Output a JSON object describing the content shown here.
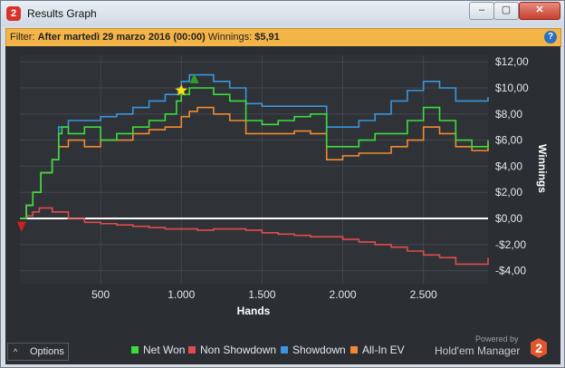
{
  "window": {
    "title": "Results Graph",
    "app_icon": "2",
    "min": "–",
    "max": "▢",
    "close": "✕"
  },
  "filter": {
    "label": "Filter:",
    "value": "After martedì 29 marzo 2016 (00:00)",
    "winnings_label": "Winnings:",
    "winnings_value": "$5,91",
    "help_icon": "?"
  },
  "chart_data": {
    "type": "line",
    "xlabel": "Hands",
    "ylabel": "Winnings",
    "xlim": [
      0,
      2900
    ],
    "ylim": [
      -5,
      12.5
    ],
    "x_ticks": [
      500,
      1000,
      1500,
      2000,
      2500
    ],
    "x_tick_labels": [
      "500",
      "1.000",
      "1.500",
      "2.000",
      "2.500"
    ],
    "y_ticks": [
      12,
      10,
      8,
      6,
      4,
      2,
      0,
      -2,
      -4
    ],
    "y_tick_labels": [
      "$12,00",
      "$10,00",
      "$8,00",
      "$6,00",
      "$4,00",
      "$2,00",
      "$0,00",
      "-$2,00",
      "-$4,00"
    ],
    "grid": true,
    "legend_position": "bottom",
    "series": [
      {
        "name": "Net Won",
        "color": "#3ddc3d",
        "x": [
          0,
          40,
          80,
          130,
          200,
          240,
          260,
          300,
          400,
          500,
          600,
          700,
          800,
          900,
          970,
          1000,
          1050,
          1100,
          1200,
          1300,
          1400,
          1450,
          1500,
          1600,
          1700,
          1800,
          1900,
          1950,
          2000,
          2100,
          2200,
          2300,
          2400,
          2500,
          2600,
          2700,
          2800,
          2900
        ],
        "y": [
          0,
          1,
          2,
          3.5,
          4.5,
          6.5,
          7,
          6.5,
          7,
          6,
          6.5,
          7,
          7.5,
          8,
          9,
          9.5,
          10,
          10,
          9.5,
          9,
          7.5,
          7.5,
          7.2,
          7.5,
          7.8,
          8,
          5.5,
          5.5,
          5.5,
          6,
          6.5,
          6.5,
          7.5,
          8.5,
          7.5,
          6,
          5.5,
          6
        ]
      },
      {
        "name": "Non Showdown",
        "color": "#e04c4c",
        "x": [
          0,
          40,
          80,
          120,
          200,
          300,
          400,
          500,
          600,
          700,
          800,
          900,
          1000,
          1100,
          1200,
          1300,
          1400,
          1500,
          1600,
          1700,
          1800,
          1900,
          2000,
          2100,
          2200,
          2300,
          2400,
          2500,
          2600,
          2700,
          2800,
          2900
        ],
        "y": [
          0,
          0.2,
          0.5,
          0.8,
          0.5,
          0,
          -0.3,
          -0.4,
          -0.5,
          -0.6,
          -0.7,
          -0.8,
          -0.8,
          -0.9,
          -0.8,
          -0.8,
          -0.9,
          -1.1,
          -1.2,
          -1.3,
          -1.4,
          -1.4,
          -1.6,
          -1.8,
          -2,
          -2.2,
          -2.5,
          -2.8,
          -3,
          -3.5,
          -3.5,
          -3
        ]
      },
      {
        "name": "Showdown",
        "color": "#3c96dc",
        "x": [
          0,
          40,
          80,
          130,
          200,
          240,
          300,
          400,
          500,
          600,
          700,
          800,
          900,
          980,
          1000,
          1050,
          1100,
          1200,
          1300,
          1400,
          1450,
          1500,
          1600,
          1700,
          1800,
          1900,
          1950,
          2000,
          2100,
          2200,
          2300,
          2400,
          2500,
          2600,
          2650,
          2700,
          2800,
          2900
        ],
        "y": [
          0,
          1,
          2,
          3.5,
          4.5,
          7,
          7.5,
          7.5,
          7.8,
          8,
          8.5,
          9,
          9.5,
          10,
          10.5,
          11,
          11,
          10.5,
          10,
          8.8,
          8.8,
          8.6,
          8.6,
          8.6,
          8.6,
          7,
          7,
          7,
          7.5,
          8,
          9,
          9.8,
          10.5,
          10,
          10,
          9,
          9,
          9.3
        ]
      },
      {
        "name": "All-In EV",
        "color": "#f08a30",
        "x": [
          0,
          40,
          80,
          130,
          200,
          240,
          300,
          400,
          500,
          600,
          700,
          800,
          900,
          1000,
          1050,
          1100,
          1200,
          1300,
          1400,
          1500,
          1600,
          1700,
          1800,
          1900,
          1950,
          2000,
          2100,
          2200,
          2300,
          2400,
          2500,
          2600,
          2700,
          2800,
          2900
        ],
        "y": [
          0,
          1,
          2,
          3.5,
          4.5,
          5.5,
          6,
          5.5,
          6,
          6,
          6.5,
          6.8,
          7,
          7.8,
          8.2,
          8.5,
          8,
          7.5,
          6.5,
          6.5,
          6.5,
          6.7,
          6.5,
          4.5,
          4.5,
          4.8,
          5,
          5,
          5.5,
          6,
          7,
          6.5,
          5.5,
          5.2,
          5.8
        ]
      }
    ],
    "markers": [
      {
        "kind": "star",
        "x": 1000,
        "y": 9.8,
        "color": "#f7e31a"
      },
      {
        "kind": "triangle-up",
        "x": 1080,
        "y": 10.7,
        "color": "#2f9e2f"
      },
      {
        "kind": "triangle-down",
        "x": 10,
        "y": -0.6,
        "color": "#d02020"
      }
    ]
  },
  "footer": {
    "options_label": "Options",
    "options_icon": "^",
    "legend": [
      "Net Won",
      "Non Showdown",
      "Showdown",
      "All-In EV"
    ],
    "powered_by": "Powered by",
    "brand": "Hold'em Manager",
    "brand_logo": "2"
  }
}
